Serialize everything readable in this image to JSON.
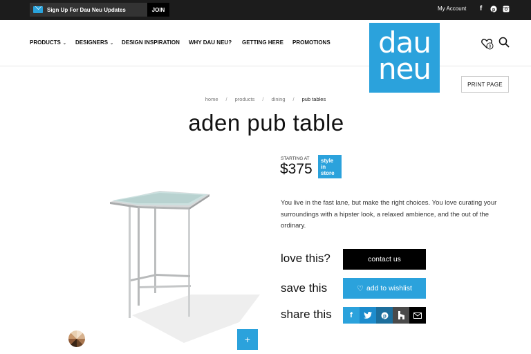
{
  "topbar": {
    "signup_text": "Sign Up For Dau Neu Updates",
    "join_label": "JOIN",
    "my_account": "My Account",
    "social": [
      "f",
      "P",
      "instagram"
    ]
  },
  "nav": {
    "items": [
      {
        "label": "PRODUCTS",
        "dropdown": true
      },
      {
        "label": "DESIGNERS",
        "dropdown": true
      },
      {
        "label": "DESIGN INSPIRATION",
        "dropdown": false
      },
      {
        "label": "WHY DAU NEU?",
        "dropdown": false
      },
      {
        "label": "GETTING HERE",
        "dropdown": false
      },
      {
        "label": "PROMOTIONS",
        "dropdown": false
      }
    ],
    "logo_line1": "dau",
    "logo_line2": "neu",
    "wishlist_count": "0"
  },
  "print_label": "PRINT PAGE",
  "breadcrumb": [
    "home",
    "products",
    "dining",
    "pub tables"
  ],
  "product": {
    "title": "aden pub table",
    "starting_at": "STARTING AT",
    "price": "$375",
    "badge": [
      "style",
      "in",
      "store"
    ],
    "description": "You live in the fast lane, but make the right choices. You love curating your surroundings with a hipster look, a relaxed ambience, and the out of the ordinary."
  },
  "actions": {
    "love_label": "love this?",
    "contact_label": "contact us",
    "save_label": "save this",
    "wishlist_label": "add to wishlist",
    "share_label": "share this"
  },
  "plus_label": "+",
  "colors": {
    "brand": "#2ba2dc",
    "topbar": "#1c1c1c",
    "facebook": "#3b5998",
    "twitter": "#1da1f2",
    "pinterest": "#1c6e9c",
    "houzz": "#4a4a4a",
    "email": "#000000"
  }
}
